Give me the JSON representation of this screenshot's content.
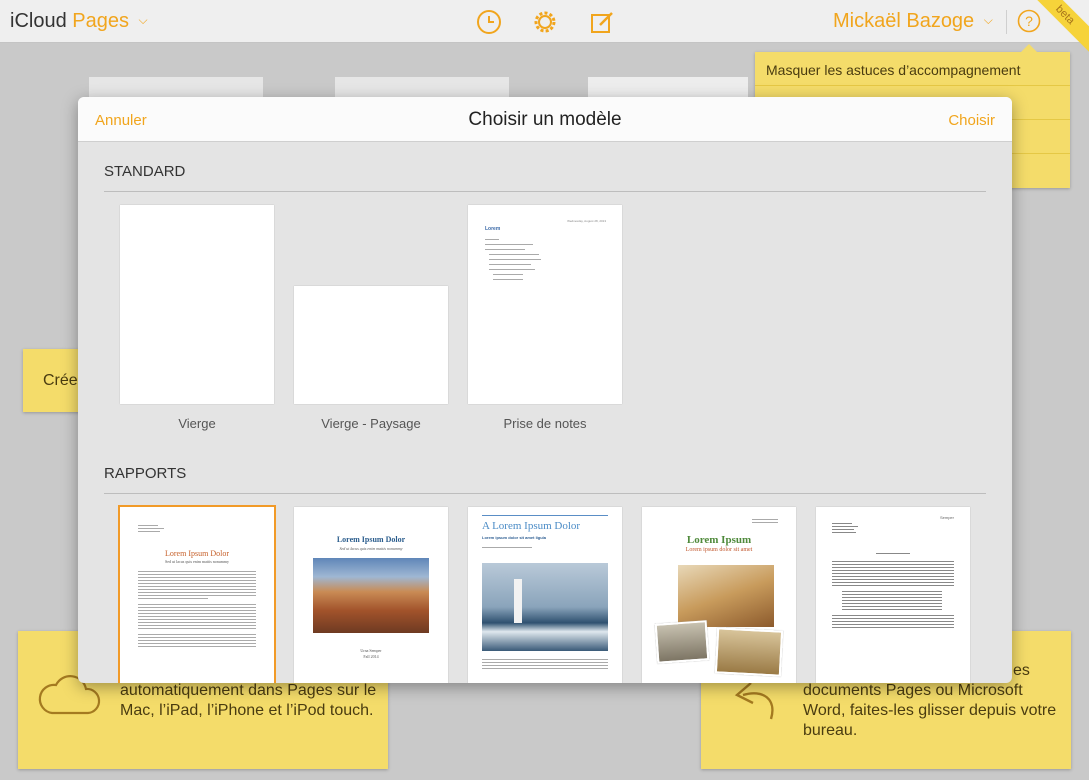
{
  "topbar": {
    "brand_icloud": "iCloud",
    "brand_app": "Pages",
    "user_name": "Mickaël Bazoge",
    "beta": "beta",
    "icons": [
      "clock-icon",
      "gear-icon",
      "compose-icon",
      "help-icon",
      "chevron-down-icon"
    ]
  },
  "tips": {
    "items": [
      "Masquer les astuces d’accompagnement",
      "",
      "",
      ""
    ]
  },
  "notes": {
    "left": "Crée",
    "bottom_left": "automatiquement dans Pages sur le Mac, l’iPad, l’iPhone et l’iPod touch.",
    "bottom_right_top": "es",
    "bottom_right": "documents Pages ou Microsoft Word, faites-les glisser depuis votre bureau."
  },
  "modal": {
    "cancel": "Annuler",
    "title": "Choisir un modèle",
    "choose": "Choisir",
    "standard": {
      "header": "STANDARD",
      "templates": [
        {
          "label": "Vierge"
        },
        {
          "label": "Vierge - Paysage"
        },
        {
          "label": "Prise de notes"
        }
      ],
      "notes_thumb": {
        "date": "Wednesday, August 28, 2013",
        "title": "Lorem"
      }
    },
    "rapports": {
      "header": "RAPPORTS",
      "thumbs": [
        {
          "title": "Lorem Ipsum Dolor",
          "subtitle": "Sed ut lacus quis enim mattis nonummy"
        },
        {
          "title": "Lorem Ipsum Dolor",
          "subtitle": "Sed ut lacus quis enim mattis nonummy",
          "footer_name": "Urna Semper",
          "footer_date": "Fall 2014"
        },
        {
          "title": "A Lorem Ipsum Dolor",
          "subtitle": "Lorem ipsum dolor sit amet ligula"
        },
        {
          "title": "Lorem Ipsum",
          "subtitle": "Lorem ipsum dolor sit amet"
        },
        {
          "title": "Semper"
        }
      ]
    }
  },
  "colors": {
    "accent": "#f1a51d",
    "note": "#f4dc6a",
    "selected_outline": "#f19a28"
  }
}
